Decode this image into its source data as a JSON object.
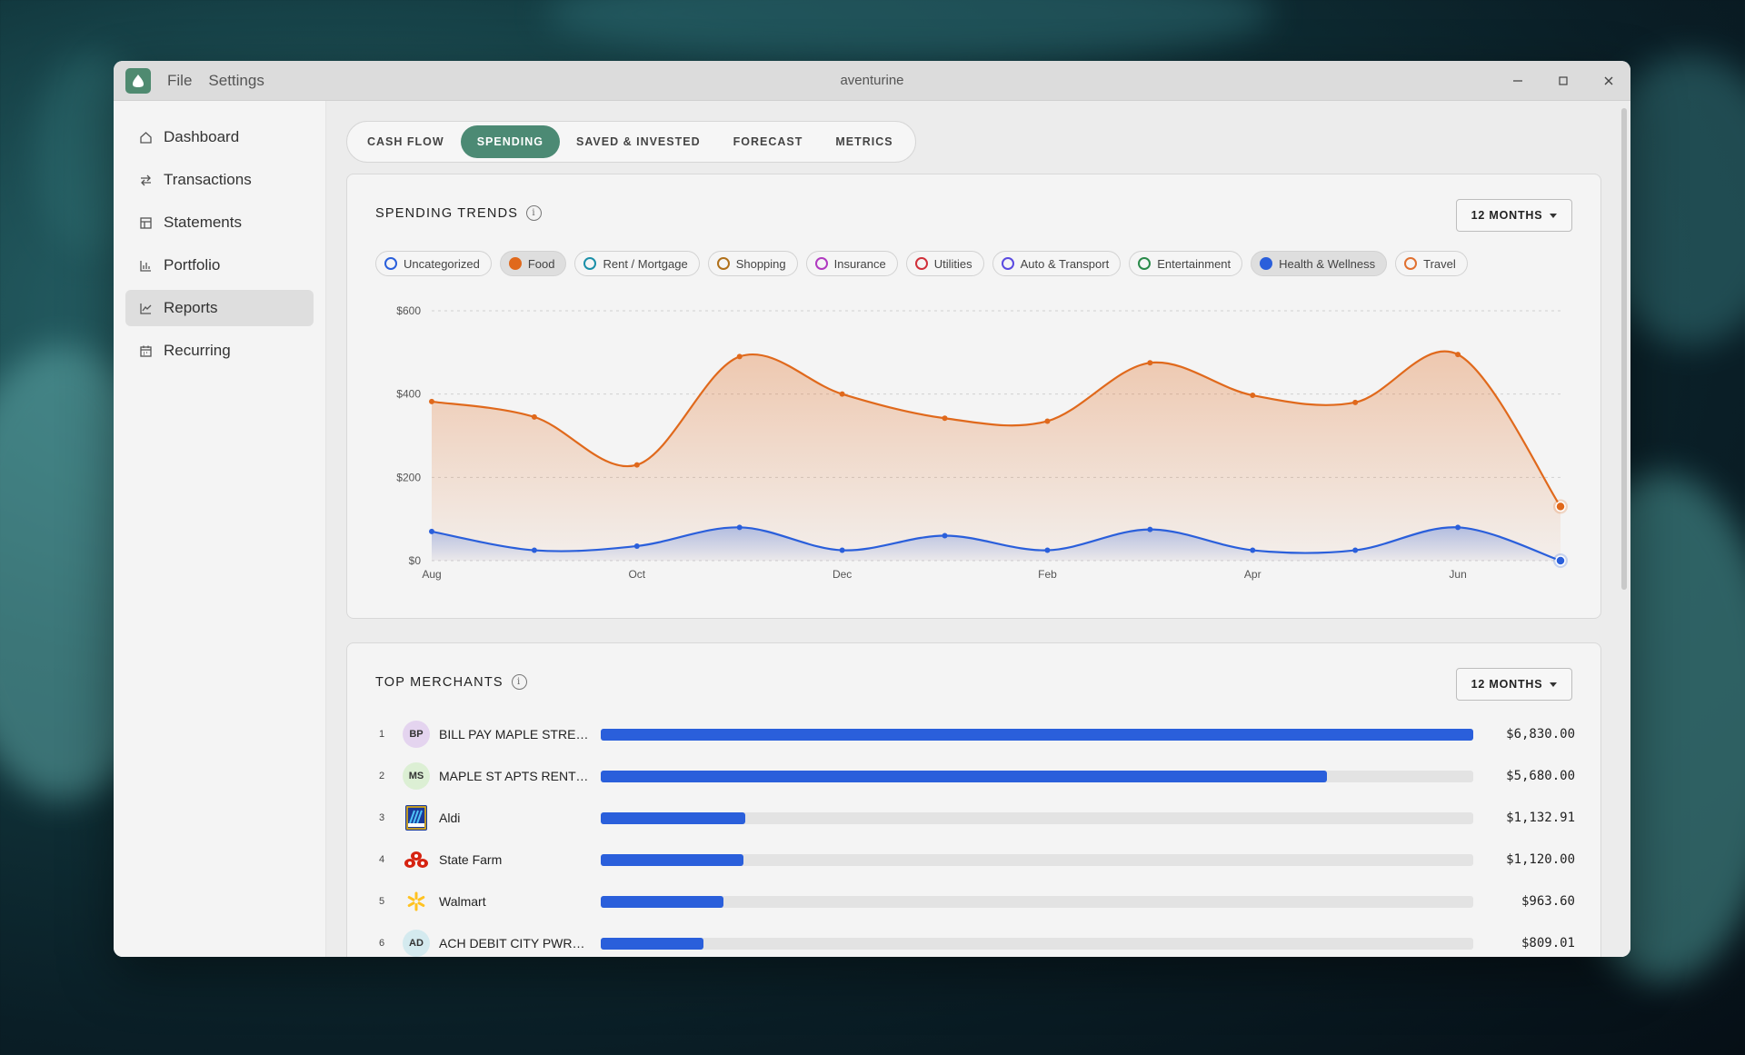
{
  "window": {
    "title": "aventurine"
  },
  "menu": {
    "file": "File",
    "settings": "Settings"
  },
  "sidebar": {
    "items": [
      {
        "label": "Dashboard",
        "icon": "home-icon",
        "active": false
      },
      {
        "label": "Transactions",
        "icon": "arrows-swap-icon",
        "active": false
      },
      {
        "label": "Statements",
        "icon": "table-icon",
        "active": false
      },
      {
        "label": "Portfolio",
        "icon": "bar-chart-icon",
        "active": false
      },
      {
        "label": "Reports",
        "icon": "line-chart-icon",
        "active": true
      },
      {
        "label": "Recurring",
        "icon": "calendar-icon",
        "active": false
      }
    ]
  },
  "tabs": [
    {
      "label": "CASH FLOW",
      "active": false
    },
    {
      "label": "SPENDING",
      "active": true
    },
    {
      "label": "SAVED & INVESTED",
      "active": false
    },
    {
      "label": "FORECAST",
      "active": false
    },
    {
      "label": "METRICS",
      "active": false
    }
  ],
  "trends": {
    "title": "SPENDING TRENDS",
    "range": "12 MONTHS",
    "legend": [
      {
        "label": "Uncategorized",
        "color": "#2a5fdb",
        "filled": false
      },
      {
        "label": "Food",
        "color": "#e0691c",
        "filled": true
      },
      {
        "label": "Rent / Mortgage",
        "color": "#1a8fa8",
        "filled": false
      },
      {
        "label": "Shopping",
        "color": "#b0701a",
        "filled": false
      },
      {
        "label": "Insurance",
        "color": "#b03ac0",
        "filled": false
      },
      {
        "label": "Utilities",
        "color": "#d0303a",
        "filled": false
      },
      {
        "label": "Auto & Transport",
        "color": "#5a4ae0",
        "filled": false
      },
      {
        "label": "Entertainment",
        "color": "#2a8a4a",
        "filled": false
      },
      {
        "label": "Health & Wellness",
        "color": "#2a5fdb",
        "filled": true
      },
      {
        "label": "Travel",
        "color": "#e07030",
        "filled": false
      }
    ]
  },
  "chart_data": {
    "type": "area",
    "x": [
      "Aug",
      "Sep",
      "Oct",
      "Nov",
      "Dec",
      "Jan",
      "Feb",
      "Mar",
      "Apr",
      "May",
      "Jun",
      "Jul"
    ],
    "x_tick_labels": [
      "Aug",
      "Oct",
      "Dec",
      "Feb",
      "Apr",
      "Jun"
    ],
    "y_tick_labels": [
      "$0",
      "$200",
      "$400",
      "$600"
    ],
    "ylim": [
      0,
      600
    ],
    "grid": true,
    "series": [
      {
        "name": "Food",
        "color": "#e0691c",
        "values": [
          382,
          345,
          230,
          490,
          400,
          342,
          335,
          475,
          397,
          380,
          495,
          130
        ]
      },
      {
        "name": "Health & Wellness",
        "color": "#2a5fdb",
        "values": [
          70,
          25,
          35,
          80,
          25,
          60,
          25,
          75,
          25,
          25,
          80,
          0
        ]
      }
    ]
  },
  "merchants": {
    "title": "TOP MERCHANTS",
    "range": "12 MONTHS",
    "items": [
      {
        "rank": "1",
        "initials": "BP",
        "avatar_bg": "#e4d4ef",
        "name": "BILL PAY MAPLE STREET ...",
        "amount": "$6,830.00",
        "share": 1.0
      },
      {
        "rank": "2",
        "initials": "MS",
        "avatar_bg": "#dcefd4",
        "name": "MAPLE ST APTS RENT P...",
        "amount": "$5,680.00",
        "share": 0.832
      },
      {
        "rank": "3",
        "initials": "",
        "avatar_bg": "#1a3a9a",
        "name": "Aldi",
        "amount": "$1,132.91",
        "share": 0.166
      },
      {
        "rank": "4",
        "initials": "",
        "avatar_bg": "transparent",
        "name": "State Farm",
        "amount": "$1,120.00",
        "share": 0.164
      },
      {
        "rank": "5",
        "initials": "",
        "avatar_bg": "transparent",
        "name": "Walmart",
        "amount": "$963.60",
        "share": 0.141
      },
      {
        "rank": "6",
        "initials": "AD",
        "avatar_bg": "#d4eaef",
        "name": "ACH DEBIT CITY PWR&L...",
        "amount": "$809.01",
        "share": 0.118
      }
    ]
  }
}
